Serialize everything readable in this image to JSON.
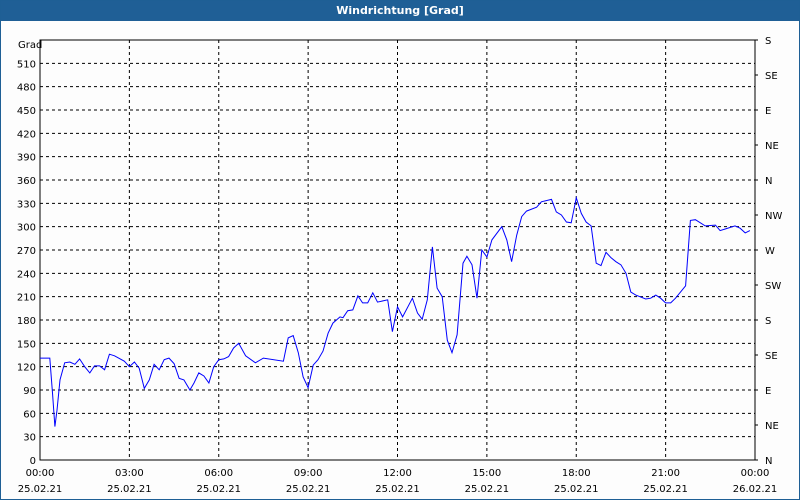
{
  "window": {
    "title": "Windrichtung [Grad]"
  },
  "chart_data": {
    "type": "line",
    "title": "Windrichtung [Grad]",
    "ylabel": "Grad",
    "ylim": [
      0,
      540
    ],
    "xlim_hours": [
      0,
      24
    ],
    "grid": true,
    "y_ticks": [
      0,
      30,
      60,
      90,
      120,
      150,
      180,
      210,
      240,
      270,
      300,
      330,
      360,
      390,
      420,
      450,
      480,
      510
    ],
    "right_ticks": [
      {
        "value": 0,
        "label": "N"
      },
      {
        "value": 45,
        "label": "NE"
      },
      {
        "value": 90,
        "label": "E"
      },
      {
        "value": 135,
        "label": "SE"
      },
      {
        "value": 180,
        "label": "S"
      },
      {
        "value": 225,
        "label": "SW"
      },
      {
        "value": 270,
        "label": "W"
      },
      {
        "value": 315,
        "label": "NW"
      },
      {
        "value": 360,
        "label": "N"
      },
      {
        "value": 405,
        "label": "NE"
      },
      {
        "value": 450,
        "label": "E"
      },
      {
        "value": 495,
        "label": "SE"
      },
      {
        "value": 540,
        "label": "S"
      }
    ],
    "x_ticks": [
      {
        "hour": 0,
        "time": "00:00",
        "date": "25.02.21"
      },
      {
        "hour": 3,
        "time": "03:00",
        "date": "25.02.21"
      },
      {
        "hour": 6,
        "time": "06:00",
        "date": "25.02.21"
      },
      {
        "hour": 9,
        "time": "09:00",
        "date": "25.02.21"
      },
      {
        "hour": 12,
        "time": "12:00",
        "date": "25.02.21"
      },
      {
        "hour": 15,
        "time": "15:00",
        "date": "25.02.21"
      },
      {
        "hour": 18,
        "time": "18:00",
        "date": "25.02.21"
      },
      {
        "hour": 21,
        "time": "21:00",
        "date": "25.02.21"
      },
      {
        "hour": 24,
        "time": "00:00",
        "date": "26.02.21"
      }
    ],
    "series": [
      {
        "name": "Windrichtung",
        "color": "#0000ff",
        "points": [
          [
            0,
            131
          ],
          [
            0.33,
            131
          ],
          [
            0.42,
            86
          ],
          [
            0.5,
            43
          ],
          [
            0.57,
            64
          ],
          [
            0.67,
            103
          ],
          [
            0.83,
            125
          ],
          [
            1,
            126
          ],
          [
            1.17,
            123
          ],
          [
            1.33,
            130
          ],
          [
            1.5,
            120
          ],
          [
            1.67,
            112
          ],
          [
            1.83,
            121
          ],
          [
            2,
            121
          ],
          [
            2.17,
            116
          ],
          [
            2.33,
            136
          ],
          [
            2.5,
            134
          ],
          [
            2.83,
            127
          ],
          [
            3,
            120
          ],
          [
            3.17,
            126
          ],
          [
            3.33,
            118
          ],
          [
            3.5,
            92
          ],
          [
            3.67,
            103
          ],
          [
            3.83,
            123
          ],
          [
            4,
            116
          ],
          [
            4.17,
            129
          ],
          [
            4.33,
            131
          ],
          [
            4.5,
            124
          ],
          [
            4.67,
            105
          ],
          [
            4.83,
            103
          ],
          [
            5.03,
            90
          ],
          [
            5.17,
            99
          ],
          [
            5.33,
            112
          ],
          [
            5.5,
            108
          ],
          [
            5.67,
            99
          ],
          [
            5.83,
            120
          ],
          [
            6,
            129
          ],
          [
            6.17,
            130
          ],
          [
            6.33,
            133
          ],
          [
            6.5,
            144
          ],
          [
            6.67,
            150
          ],
          [
            6.9,
            134
          ],
          [
            7.23,
            125
          ],
          [
            7.5,
            131
          ],
          [
            8.17,
            127
          ],
          [
            8.33,
            157
          ],
          [
            8.5,
            160
          ],
          [
            8.67,
            138
          ],
          [
            8.83,
            107
          ],
          [
            9,
            93
          ],
          [
            9.17,
            122
          ],
          [
            9.33,
            129
          ],
          [
            9.5,
            140
          ],
          [
            9.67,
            163
          ],
          [
            9.83,
            176
          ],
          [
            10.07,
            184
          ],
          [
            10.17,
            183
          ],
          [
            10.33,
            192
          ],
          [
            10.5,
            193
          ],
          [
            10.67,
            211
          ],
          [
            10.83,
            202
          ],
          [
            11,
            202
          ],
          [
            11.17,
            215
          ],
          [
            11.33,
            203
          ],
          [
            11.67,
            206
          ],
          [
            11.83,
            165
          ],
          [
            12,
            197
          ],
          [
            12.17,
            184
          ],
          [
            12.5,
            208
          ],
          [
            12.67,
            189
          ],
          [
            12.83,
            181
          ],
          [
            13,
            206
          ],
          [
            13.17,
            274
          ],
          [
            13.33,
            221
          ],
          [
            13.5,
            210
          ],
          [
            13.67,
            154
          ],
          [
            13.83,
            138
          ],
          [
            14,
            161
          ],
          [
            14.2,
            253
          ],
          [
            14.33,
            262
          ],
          [
            14.5,
            251
          ],
          [
            14.67,
            208
          ],
          [
            14.83,
            270
          ],
          [
            15,
            261
          ],
          [
            15.17,
            283
          ],
          [
            15.5,
            300
          ],
          [
            15.67,
            283
          ],
          [
            15.83,
            255
          ],
          [
            16,
            289
          ],
          [
            16.17,
            313
          ],
          [
            16.33,
            320
          ],
          [
            16.67,
            325
          ],
          [
            16.83,
            332
          ],
          [
            17.17,
            335
          ],
          [
            17.33,
            319
          ],
          [
            17.5,
            315
          ],
          [
            17.67,
            306
          ],
          [
            17.83,
            305
          ],
          [
            18,
            337
          ],
          [
            18.17,
            317
          ],
          [
            18.33,
            306
          ],
          [
            18.5,
            301
          ],
          [
            18.67,
            253
          ],
          [
            18.83,
            250
          ],
          [
            19,
            267
          ],
          [
            19.17,
            260
          ],
          [
            19.33,
            255
          ],
          [
            19.5,
            251
          ],
          [
            19.67,
            240
          ],
          [
            19.83,
            216
          ],
          [
            20,
            212
          ],
          [
            20.33,
            207
          ],
          [
            20.5,
            208
          ],
          [
            20.67,
            212
          ],
          [
            20.83,
            208
          ],
          [
            21,
            202
          ],
          [
            21.17,
            202
          ],
          [
            21.33,
            208
          ],
          [
            21.67,
            224
          ],
          [
            21.83,
            308
          ],
          [
            22,
            309
          ],
          [
            22.33,
            301
          ],
          [
            22.67,
            302
          ],
          [
            22.83,
            295
          ],
          [
            23,
            297
          ],
          [
            23.33,
            301
          ],
          [
            23.5,
            298
          ],
          [
            23.67,
            292
          ],
          [
            23.83,
            295
          ]
        ]
      }
    ]
  }
}
